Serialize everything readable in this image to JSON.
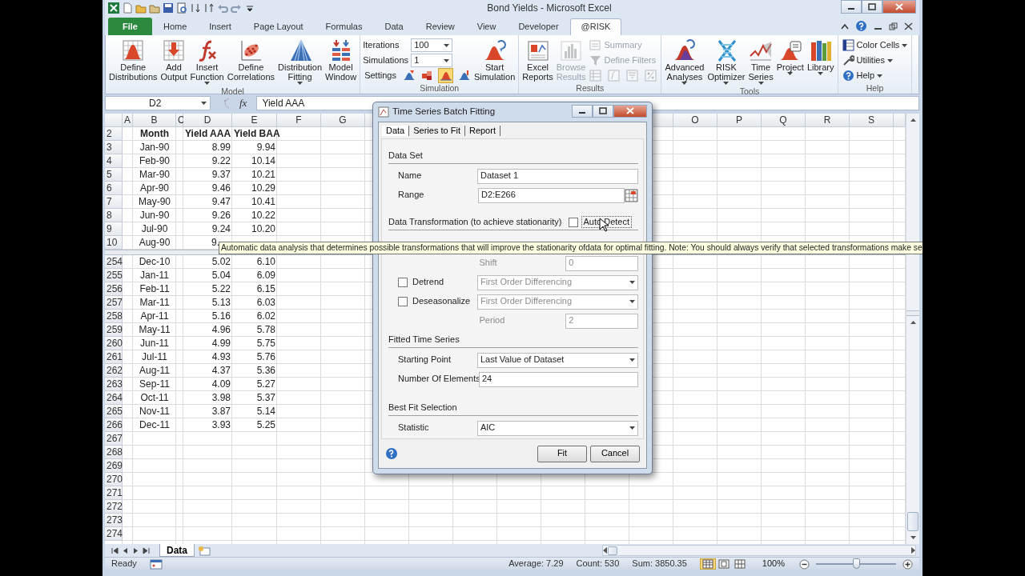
{
  "window": {
    "title": "Bond Yields  -  Microsoft Excel"
  },
  "ribbon_tabs": [
    {
      "label": "File",
      "kind": "file",
      "selected": false
    },
    {
      "label": "Home",
      "kind": "tab",
      "selected": false
    },
    {
      "label": "Insert",
      "kind": "tab",
      "selected": false
    },
    {
      "label": "Page Layout",
      "kind": "tab",
      "selected": false
    },
    {
      "label": "Formulas",
      "kind": "tab",
      "selected": false
    },
    {
      "label": "Data",
      "kind": "tab",
      "selected": false
    },
    {
      "label": "Review",
      "kind": "tab",
      "selected": false
    },
    {
      "label": "View",
      "kind": "tab",
      "selected": false
    },
    {
      "label": "Developer",
      "kind": "tab",
      "selected": false
    },
    {
      "label": "@RISK",
      "kind": "tab",
      "selected": true
    }
  ],
  "ribbon_groups": [
    {
      "label": "Model",
      "items": [
        {
          "kind": "large",
          "label": "Define Distributions",
          "dropdown": false,
          "disabled": false
        },
        {
          "kind": "large",
          "label": "Add Output",
          "dropdown": false,
          "disabled": false
        },
        {
          "kind": "large",
          "label": "Insert Function",
          "dropdown": true,
          "disabled": false
        },
        {
          "kind": "large",
          "label": "Define Correlations",
          "dropdown": false,
          "disabled": false
        },
        {
          "kind": "large",
          "label": "Distribution Fitting",
          "dropdown": true,
          "disabled": false
        },
        {
          "kind": "large",
          "label": "Model Window",
          "dropdown": false,
          "disabled": false
        }
      ]
    },
    {
      "label": "Simulation",
      "items": [
        {
          "kind": "stack",
          "rows": [
            {
              "kind": "combo",
              "label": "Iterations",
              "value": "100"
            },
            {
              "kind": "combo",
              "label": "Simulations",
              "value": "1"
            },
            {
              "kind": "icons",
              "label": "Settings",
              "icons": [
                {
                  "selected": false,
                  "disabled": false
                },
                {
                  "selected": false,
                  "disabled": false
                },
                {
                  "selected": true,
                  "disabled": false
                },
                {
                  "selected": false,
                  "disabled": false
                }
              ]
            }
          ]
        },
        {
          "kind": "large",
          "label": "Start Simulation",
          "dropdown": false,
          "disabled": false
        }
      ]
    },
    {
      "label": "Results",
      "items": [
        {
          "kind": "large",
          "label": "Excel Reports",
          "dropdown": false,
          "disabled": false
        },
        {
          "kind": "large",
          "label": "Browse Results",
          "dropdown": false,
          "disabled": true
        },
        {
          "kind": "stack",
          "rows": [
            {
              "kind": "small",
              "label": "Summary",
              "dropdown": false,
              "disabled": true
            },
            {
              "kind": "small",
              "label": "Define Filters",
              "dropdown": false,
              "disabled": true
            },
            {
              "kind": "icons",
              "icons": [
                {
                  "selected": false,
                  "disabled": true
                },
                {
                  "selected": false,
                  "disabled": true
                },
                {
                  "selected": false,
                  "disabled": true
                },
                {
                  "selected": false,
                  "disabled": true
                }
              ]
            }
          ]
        }
      ]
    },
    {
      "label": "Tools",
      "items": [
        {
          "kind": "large",
          "label": "Advanced Analyses",
          "dropdown": true,
          "disabled": false
        },
        {
          "kind": "large",
          "label": "RISK Optimizer",
          "dropdown": true,
          "disabled": false
        },
        {
          "kind": "large",
          "label": "Time Series",
          "dropdown": true,
          "disabled": false
        },
        {
          "kind": "large",
          "label": "Project",
          "dropdown": true,
          "disabled": false
        },
        {
          "kind": "large",
          "label": "Library",
          "dropdown": true,
          "disabled": false
        }
      ]
    },
    {
      "label": "Help",
      "items": [
        {
          "kind": "stack",
          "rows": [
            {
              "kind": "small",
              "label": "Color Cells",
              "dropdown": true,
              "disabled": false
            },
            {
              "kind": "small",
              "label": "Utilities",
              "dropdown": true,
              "disabled": false
            },
            {
              "kind": "small",
              "label": "Help",
              "dropdown": true,
              "disabled": false
            }
          ]
        }
      ]
    }
  ],
  "formula_bar": {
    "name_box": "D2",
    "function_button": "fx",
    "formula": "Yield AAA"
  },
  "columns_left": [
    "A",
    "B",
    "C",
    "D",
    "E",
    "F",
    "G"
  ],
  "columns_right": [
    "O",
    "P",
    "Q",
    "R",
    "S"
  ],
  "header_row": {
    "number": "2",
    "month": "Month",
    "aaa": "Yield AAA",
    "baa": "Yield BAA"
  },
  "rows_top": [
    {
      "number": "3",
      "month": "Jan-90",
      "aaa": "8.99",
      "baa": "9.94"
    },
    {
      "number": "4",
      "month": "Feb-90",
      "aaa": "9.22",
      "baa": "10.14"
    },
    {
      "number": "5",
      "month": "Mar-90",
      "aaa": "9.37",
      "baa": "10.21"
    },
    {
      "number": "6",
      "month": "Apr-90",
      "aaa": "9.46",
      "baa": "10.29"
    },
    {
      "number": "7",
      "month": "May-90",
      "aaa": "9.47",
      "baa": "10.41"
    },
    {
      "number": "8",
      "month": "Jun-90",
      "aaa": "9.26",
      "baa": "10.22"
    },
    {
      "number": "9",
      "month": "Jul-90",
      "aaa": "9.24",
      "baa": "10.20"
    },
    {
      "number": "10",
      "month": "Aug-90",
      "aaa": "9."
    }
  ],
  "rows_bottom": [
    {
      "number": "254",
      "month": "Dec-10",
      "aaa": "5.02",
      "baa": "6.10"
    },
    {
      "number": "255",
      "month": "Jan-11",
      "aaa": "5.04",
      "baa": "6.09"
    },
    {
      "number": "256",
      "month": "Feb-11",
      "aaa": "5.22",
      "baa": "6.15"
    },
    {
      "number": "257",
      "month": "Mar-11",
      "aaa": "5.13",
      "baa": "6.03"
    },
    {
      "number": "258",
      "month": "Apr-11",
      "aaa": "5.16",
      "baa": "6.02"
    },
    {
      "number": "259",
      "month": "May-11",
      "aaa": "4.96",
      "baa": "5.78"
    },
    {
      "number": "260",
      "month": "Jun-11",
      "aaa": "4.99",
      "baa": "5.75"
    },
    {
      "number": "261",
      "month": "Jul-11",
      "aaa": "4.93",
      "baa": "5.76"
    },
    {
      "number": "262",
      "month": "Aug-11",
      "aaa": "4.37",
      "baa": "5.36"
    },
    {
      "number": "263",
      "month": "Sep-11",
      "aaa": "4.09",
      "baa": "5.27"
    },
    {
      "number": "264",
      "month": "Oct-11",
      "aaa": "3.98",
      "baa": "5.37"
    },
    {
      "number": "265",
      "month": "Nov-11",
      "aaa": "3.87",
      "baa": "5.14"
    },
    {
      "number": "266",
      "month": "Dec-11",
      "aaa": "3.93",
      "baa": "5.25"
    },
    {
      "number": "267"
    },
    {
      "number": "268"
    },
    {
      "number": "269"
    },
    {
      "number": "270"
    },
    {
      "number": "271"
    },
    {
      "number": "272"
    },
    {
      "number": "273"
    },
    {
      "number": "274"
    }
  ],
  "sheet_tabs": [
    {
      "label": "Data",
      "selected": true
    }
  ],
  "status_bar": {
    "mode": "Ready",
    "average": "Average: 7.29",
    "count": "Count: 530",
    "sum": "Sum: 3850.35",
    "views": [
      {
        "selected": true
      },
      {
        "selected": false
      },
      {
        "selected": false
      }
    ],
    "zoom": "100%",
    "zoom_slider": {
      "level": 0.5
    }
  },
  "tooltip": {
    "text": "Automatic data analysis that determines possible transformations that will improve the stationarity ofdata for optimal fitting. Note: You should always verify that selected transformations make se"
  },
  "dialog": {
    "title": "Time Series Batch Fitting",
    "tabs": [
      {
        "label": "Data",
        "selected": true
      },
      {
        "label": "Series to Fit",
        "selected": false
      },
      {
        "label": "Report",
        "selected": false
      }
    ],
    "sections": [
      {
        "title": "Data Set",
        "rows": [
          {
            "kind": "text",
            "label": "Name",
            "value": "Dataset 1",
            "disabled": false
          },
          {
            "kind": "range",
            "label": "Range",
            "value": "D2:E266",
            "disabled": false
          }
        ]
      },
      {
        "title": "Data Transformation (to achieve stationarity)",
        "auto_detect": {
          "label": "Auto Detect",
          "checked": false
        },
        "rows": [
          {
            "kind": "subfield",
            "label": "Shift",
            "value": "0",
            "disabled": true
          },
          {
            "kind": "check-select",
            "label": "Detrend",
            "checked": false,
            "value": "First Order Differencing",
            "disabled": true
          },
          {
            "kind": "check-select",
            "label": "Deseasonalize",
            "checked": false,
            "value": "First Order Differencing",
            "disabled": true
          },
          {
            "kind": "subfield",
            "label": "Period",
            "value": "2",
            "disabled": true
          }
        ]
      },
      {
        "title": "Fitted Time Series",
        "rows": [
          {
            "kind": "select",
            "label": "Starting Point",
            "value": "Last Value of Dataset",
            "disabled": false
          },
          {
            "kind": "text",
            "label": "Number Of Elements",
            "value": "24",
            "disabled": false
          }
        ]
      },
      {
        "title": "Best Fit Selection",
        "rows": [
          {
            "kind": "select",
            "label": "Statistic",
            "value": "AIC",
            "disabled": false
          }
        ]
      }
    ],
    "buttons": [
      {
        "label": "Fit"
      },
      {
        "label": "Cancel"
      }
    ]
  }
}
